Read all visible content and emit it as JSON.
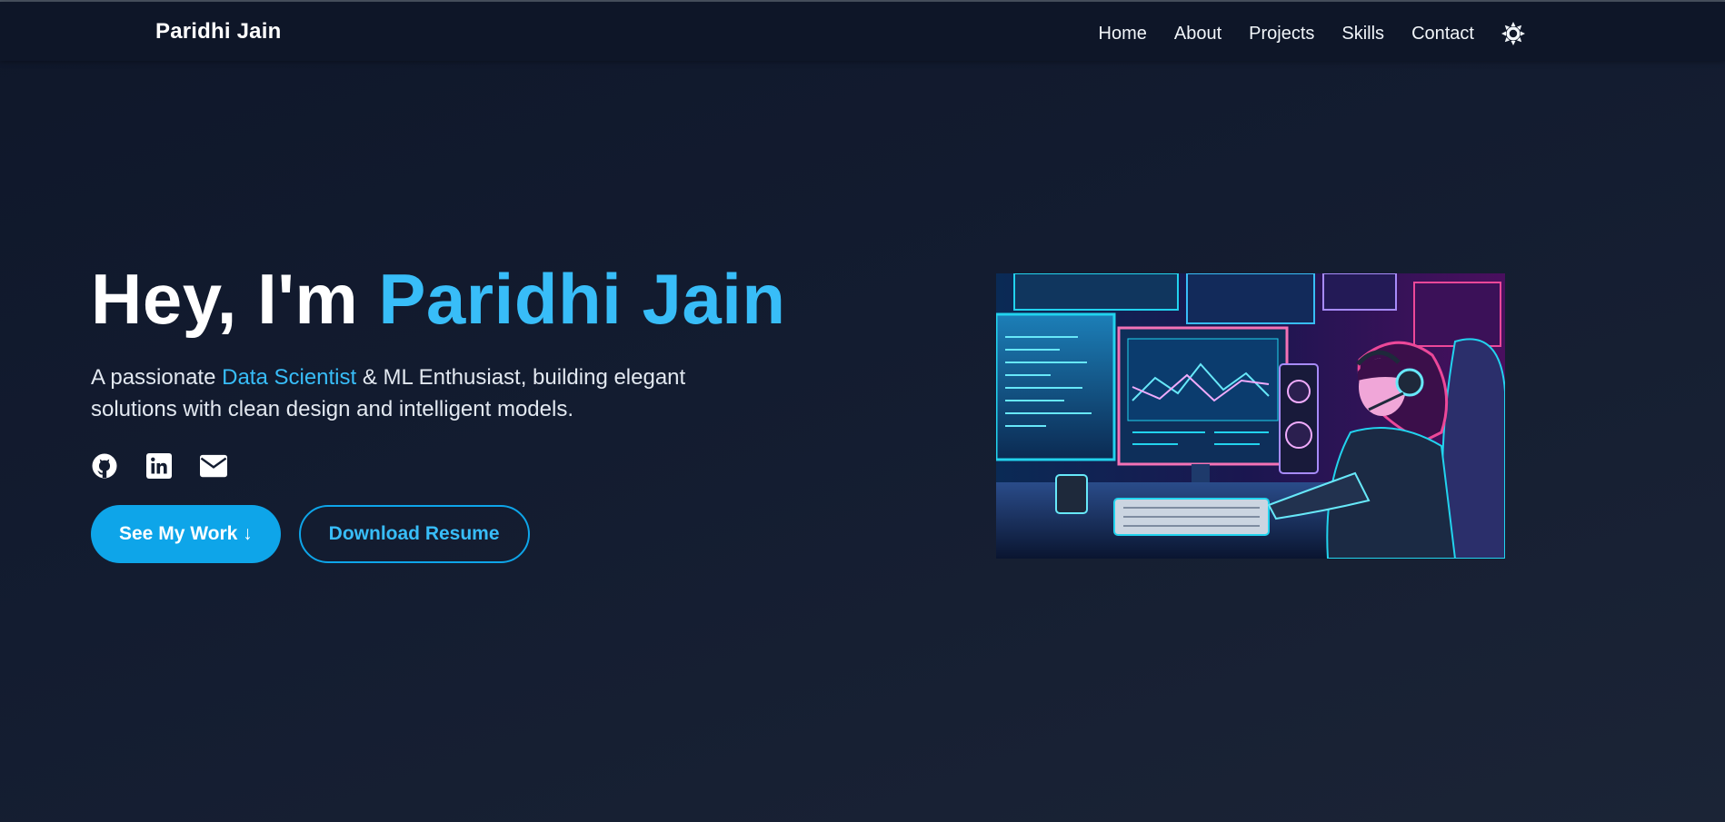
{
  "nav": {
    "brand": "Paridhi Jain",
    "links": [
      "Home",
      "About",
      "Projects",
      "Skills",
      "Contact"
    ],
    "theme_icon": "sun-icon"
  },
  "hero": {
    "title_prefix": "Hey, I'm ",
    "title_name": "Paridhi Jain",
    "subtitle_prefix": "A passionate ",
    "subtitle_highlight": "Data Scientist",
    "subtitle_rest": " & ML Enthusiast, building elegant solutions with clean design and intelligent models.",
    "socials": [
      "github-icon",
      "linkedin-icon",
      "mail-icon"
    ],
    "primary_button": "See My Work ↓",
    "secondary_button": "Download Resume",
    "image_icon": "developer-illustration"
  },
  "colors": {
    "accent": "#38bdf8",
    "button": "#0ea5e9",
    "background": "#0f172a",
    "navbar": "#0e1628"
  }
}
